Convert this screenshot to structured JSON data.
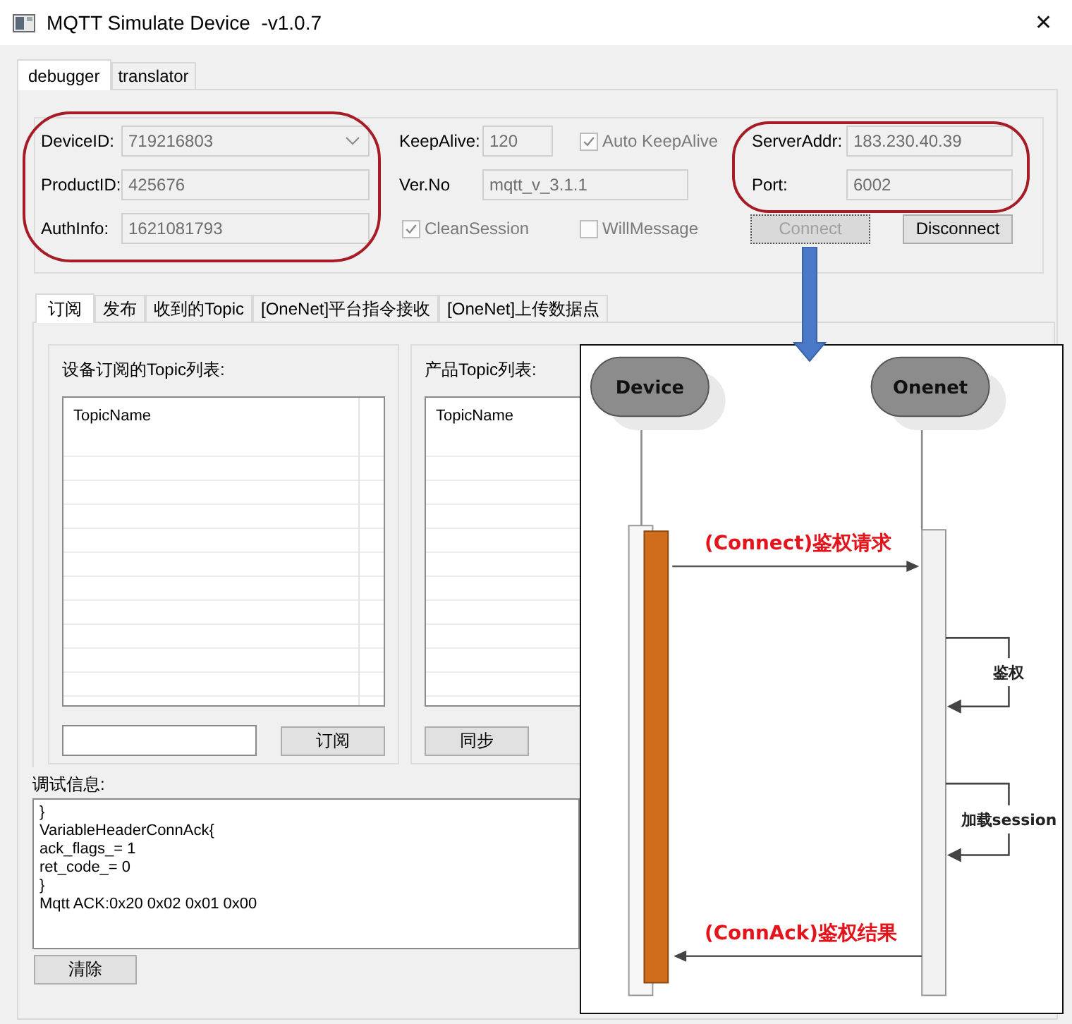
{
  "window": {
    "title": "MQTT Simulate Device  -v1.0.7",
    "close_glyph": "✕"
  },
  "tabs": [
    {
      "label": "debugger",
      "selected": true
    },
    {
      "label": "translator",
      "selected": false
    }
  ],
  "connection": {
    "identity": [
      {
        "label": "DeviceID:",
        "value": "719216803",
        "kind": "combo"
      },
      {
        "label": "ProductID:",
        "value": "425676",
        "kind": "text"
      },
      {
        "label": "AuthInfo:",
        "value": "1621081793",
        "kind": "text"
      }
    ],
    "keepalive": {
      "label": "KeepAlive:",
      "value": "120"
    },
    "auto_keepalive": {
      "label": "Auto KeepAlive",
      "checked": true,
      "disabled": true
    },
    "version": {
      "label": "Ver.No",
      "value": "mqtt_v_3.1.1"
    },
    "clean_session": {
      "label": "CleanSession",
      "checked": true,
      "disabled": true
    },
    "will_message": {
      "label": "WillMessage",
      "checked": false,
      "disabled": true
    },
    "server": [
      {
        "label": "ServerAddr:",
        "value": "183.230.40.39"
      },
      {
        "label": "Port:",
        "value": "6002"
      }
    ],
    "buttons": [
      {
        "label": "Connect",
        "disabled": true
      },
      {
        "label": "Disconnect",
        "disabled": false
      }
    ]
  },
  "subtabs": [
    {
      "label": "订阅",
      "selected": true
    },
    {
      "label": "发布",
      "selected": false
    },
    {
      "label": "收到的Topic",
      "selected": false
    },
    {
      "label": "[OneNet]平台指令接收",
      "selected": false
    },
    {
      "label": "[OneNet]上传数据点",
      "selected": false
    }
  ],
  "topic_groups": [
    {
      "kind": "subscribe",
      "title": "设备订阅的Topic列表:",
      "column": "TopicName",
      "button": "订阅"
    },
    {
      "kind": "sync",
      "title": "产品Topic列表:",
      "column": "TopicName",
      "button": "同步"
    }
  ],
  "debug": {
    "label": "调试信息:",
    "lines": [
      "}",
      "VariableHeaderConnAck{",
      "ack_flags_= 1",
      "ret_code_= 0",
      "}",
      "Mqtt ACK:0x20 0x02 0x01 0x00"
    ],
    "button": "清除"
  },
  "diagram": {
    "participants": [
      "Device",
      "Onenet"
    ],
    "messages": [
      {
        "kind": "request",
        "label": "(Connect)鉴权请求"
      },
      {
        "kind": "self",
        "label": "鉴权"
      },
      {
        "kind": "self",
        "label": "加载session"
      },
      {
        "kind": "response",
        "label": "(ConnAck)鉴权结果"
      }
    ]
  }
}
